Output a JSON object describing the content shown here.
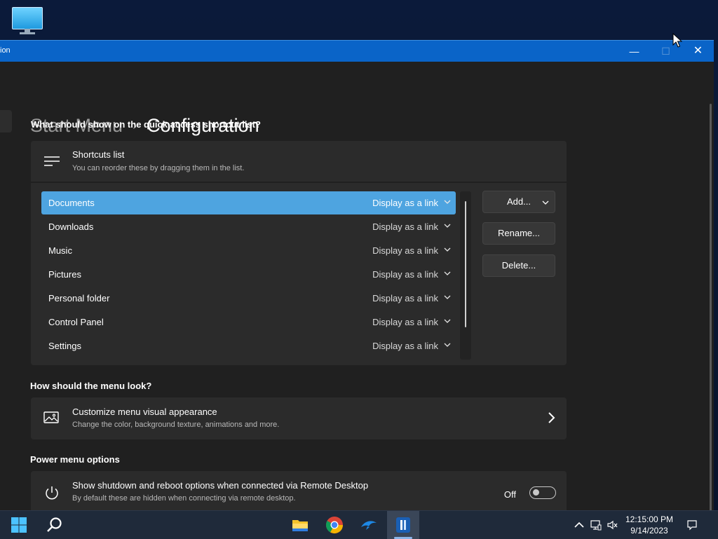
{
  "window": {
    "title": "ion",
    "minimize_glyph": "—",
    "maximize_glyph": "☐",
    "close_glyph": "✕"
  },
  "breadcrumb": {
    "parent": "Start Menu",
    "separator": "›",
    "current": "Configuration"
  },
  "sections": {
    "shortcuts_heading": "What should show on the quick access shortcut list?",
    "look_heading": "How should the menu look?",
    "power_heading": "Power menu options"
  },
  "shortcuts_card": {
    "icon": "list-lines-icon",
    "title": "Shortcuts list",
    "subtitle": "You can reorder these by dragging them in the list."
  },
  "shortcuts": [
    {
      "label": "Documents",
      "mode": "Display as a link",
      "selected": true
    },
    {
      "label": "Downloads",
      "mode": "Display as a link",
      "selected": false
    },
    {
      "label": "Music",
      "mode": "Display as a link",
      "selected": false
    },
    {
      "label": "Pictures",
      "mode": "Display as a link",
      "selected": false
    },
    {
      "label": "Personal folder",
      "mode": "Display as a link",
      "selected": false
    },
    {
      "label": "Control Panel",
      "mode": "Display as a link",
      "selected": false
    },
    {
      "label": "Settings",
      "mode": "Display as a link",
      "selected": false
    }
  ],
  "buttons": {
    "add": "Add...",
    "rename": "Rename...",
    "delete": "Delete..."
  },
  "appearance_card": {
    "icon": "image-icon",
    "title": "Customize menu visual appearance",
    "subtitle": "Change the color, background texture, animations and more."
  },
  "power_card": {
    "icon": "power-icon",
    "title": "Show shutdown and reboot options when connected via Remote Desktop",
    "subtitle": "By default these are hidden when connecting via remote desktop.",
    "toggle_label": "Off",
    "toggle_on": false
  },
  "taskbar": {
    "time": "12:15:00 PM",
    "date": "9/14/2023",
    "apps": [
      "start-icon",
      "search-icon",
      "file-explorer-icon",
      "chrome-icon",
      "dolphin-icon",
      "app-icon"
    ]
  },
  "colors": {
    "accent": "#4ea4e0",
    "titlebar": "#0a64c8",
    "window_bg": "#202020",
    "card_bg": "#2b2b2b"
  }
}
